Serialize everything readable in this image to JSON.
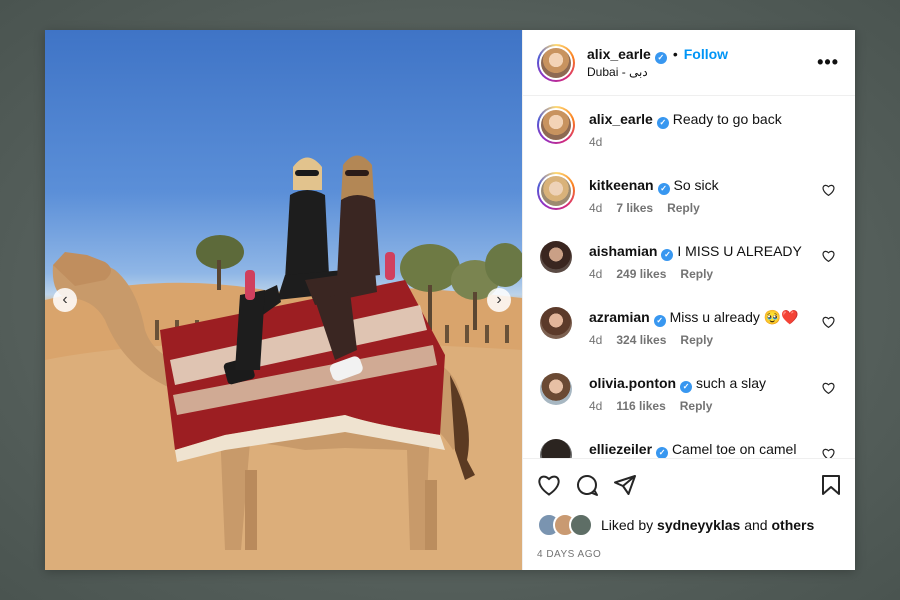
{
  "post": {
    "author": "alix_earle",
    "follow_label": "Follow",
    "separator": "•",
    "location": "Dubai - دبی",
    "more_label": "•••"
  },
  "caption": {
    "user": "alix_earle",
    "text": "Ready to go back",
    "age": "4d"
  },
  "comments": [
    {
      "user": "kitkeenan",
      "text": "So sick",
      "age": "4d",
      "likes": "7 likes",
      "reply": "Reply"
    },
    {
      "user": "aishamian",
      "text": "I MISS U ALREADY",
      "age": "4d",
      "likes": "249 likes",
      "reply": "Reply"
    },
    {
      "user": "azramian",
      "text": "Miss u already 🥹❤️",
      "age": "4d",
      "likes": "324 likes",
      "reply": "Reply"
    },
    {
      "user": "olivia.ponton",
      "text": "such a slay",
      "age": "4d",
      "likes": "116 likes",
      "reply": "Reply"
    },
    {
      "user": "elliezeiler",
      "text": "Camel toe on camel",
      "age": "",
      "likes": "",
      "reply": ""
    }
  ],
  "likes": {
    "prefix": "Liked by",
    "user": "sydneyyklas",
    "connector": "and",
    "others": "others"
  },
  "timestamp": "4 DAYS AGO",
  "icons": [
    "heart-icon",
    "comment-icon",
    "share-icon",
    "bookmark-icon",
    "verified-icon",
    "chevron-left-icon",
    "chevron-right-icon",
    "more-icon"
  ],
  "colors": {
    "verified": "#3897f0",
    "follow": "#0095f6"
  }
}
